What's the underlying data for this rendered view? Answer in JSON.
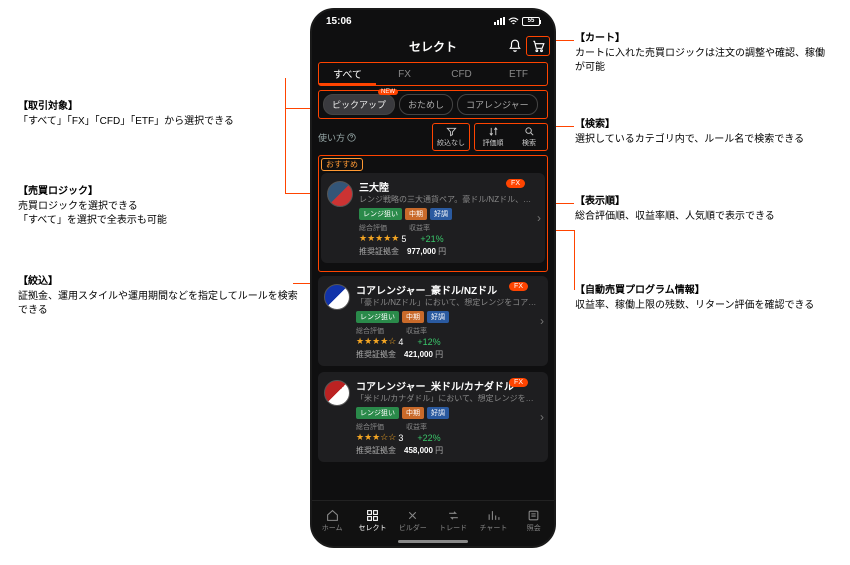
{
  "status": {
    "time": "15:06",
    "battery": "55"
  },
  "topbar": {
    "title": "セレクト"
  },
  "tabs": [
    "すべて",
    "FX",
    "CFD",
    "ETF"
  ],
  "chips": [
    {
      "label": "ピックアップ",
      "new": "NEW",
      "active": true
    },
    {
      "label": "おためし"
    },
    {
      "label": "コアレンジャー"
    }
  ],
  "usage_link": "使い方",
  "filters": {
    "narrow": "絞込なし",
    "sort": "評価順",
    "search": "検索"
  },
  "rec_label": "おすすめ",
  "cards": [
    {
      "title": "三大陸",
      "sub": "レンジ戦略の三大通貨ペア。豪ドル/NZドル、ユー…",
      "tags": [
        "レンジ狙い",
        "中期",
        "好調"
      ],
      "meta1": "総合評価",
      "meta2": "収益率",
      "stars": "★★★★★",
      "rating": "5",
      "ret": "+21%",
      "margin_label": "推奨証拠金",
      "margin_val": "977,000",
      "margin_unit": "円",
      "badge": "FX"
    },
    {
      "title": "コアレンジャー_豪ドル/NZドル",
      "sub": "「豪ドル/NZドル」において、想定レンジをコアレン…",
      "tags": [
        "レンジ狙い",
        "中期",
        "好調"
      ],
      "meta1": "総合評価",
      "meta2": "収益率",
      "stars": "★★★★☆",
      "rating": "4",
      "ret": "+12%",
      "margin_label": "推奨証拠金",
      "margin_val": "421,000",
      "margin_unit": "円",
      "badge": "FX"
    },
    {
      "title": "コアレンジャー_米ドル/カナダドル",
      "sub": "「米ドル/カナダドル」において、想定レンジを…",
      "tags": [
        "レンジ狙い",
        "中期",
        "好調"
      ],
      "meta1": "総合評価",
      "meta2": "収益率",
      "stars": "★★★☆☆",
      "rating": "3",
      "ret": "+22%",
      "margin_label": "推奨証拠金",
      "margin_val": "458,000",
      "margin_unit": "円",
      "badge": "FX"
    }
  ],
  "nav": [
    "ホーム",
    "セレクト",
    "ビルダー",
    "トレード",
    "チャート",
    "照会"
  ],
  "annos": {
    "cart_h": "【カート】",
    "cart_b": "カートに入れた売買ロジックは注文の調整や確認、稼働が可能",
    "target_h": "【取引対象】",
    "target_b": "「すべて」「FX」「CFD」「ETF」から選択できる",
    "logic_h": "【売買ロジック】",
    "logic_b": "売買ロジックを選択できる\n「すべて」を選択で全表示も可能",
    "filter_h": "【絞込】",
    "filter_b": "証拠金、運用スタイルや運用期間などを指定してルールを検索できる",
    "search_h": "【検索】",
    "search_b": "選択しているカテゴリ内で、ルール名で検索できる",
    "sort_h": "【表示順】",
    "sort_b": "総合評価順、収益率順、人気順で表示できる",
    "prog_h": "【自動売買プログラム情報】",
    "prog_b": "収益率、稼働上限の残数、リターン評価を確認できる"
  }
}
